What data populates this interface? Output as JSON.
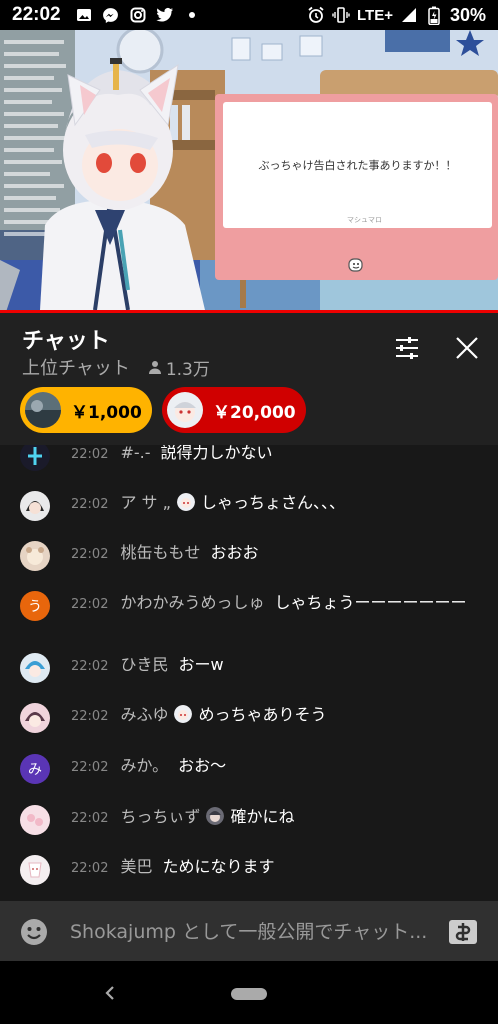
{
  "status_bar": {
    "time": "22:02",
    "network": "LTE+",
    "battery_percent": "30%"
  },
  "video": {
    "question_text": "ぶっちゃけ告白された事ありますか！！",
    "question_brand": "マシュマロ"
  },
  "chat": {
    "title": "チャット",
    "mode": "上位チャット",
    "viewers": "1.3万"
  },
  "superchats": [
    {
      "amount": "￥1,000",
      "color": "#ffb300"
    },
    {
      "amount": "￥20,000",
      "color": "#d00000"
    }
  ],
  "messages": [
    {
      "time": "22:02",
      "author": "#-.-",
      "text": "説得力しかない"
    },
    {
      "time": "22:02",
      "author": "ア サ „",
      "text": "しゃっちょさん、、、"
    },
    {
      "time": "22:02",
      "author": "桃缶ももせ",
      "text": "おおお"
    },
    {
      "time": "22:02",
      "author": "かわかみうめっしゅ",
      "text": "しゃちょうーーーーーーー",
      "avatar_letter": "う",
      "avatar_color": "#e8660c"
    },
    {
      "time": "22:02",
      "author": "ひき民",
      "text": "おーw"
    },
    {
      "time": "22:02",
      "author": "みふゆ",
      "text": "めっちゃありそう"
    },
    {
      "time": "22:02",
      "author": "みか。",
      "text": "おお〜",
      "avatar_letter": "み",
      "avatar_color": "#5a35b5"
    },
    {
      "time": "22:02",
      "author": "ちっちぃず",
      "text": "確かにね"
    },
    {
      "time": "22:02",
      "author": "美巴",
      "text": "ためになります"
    }
  ],
  "input": {
    "placeholder": "Shokajump として一般公開でチャット..."
  },
  "colors": {
    "accent_red": "#ff0000",
    "chat_bg": "#181818",
    "header_bg": "#212121"
  }
}
